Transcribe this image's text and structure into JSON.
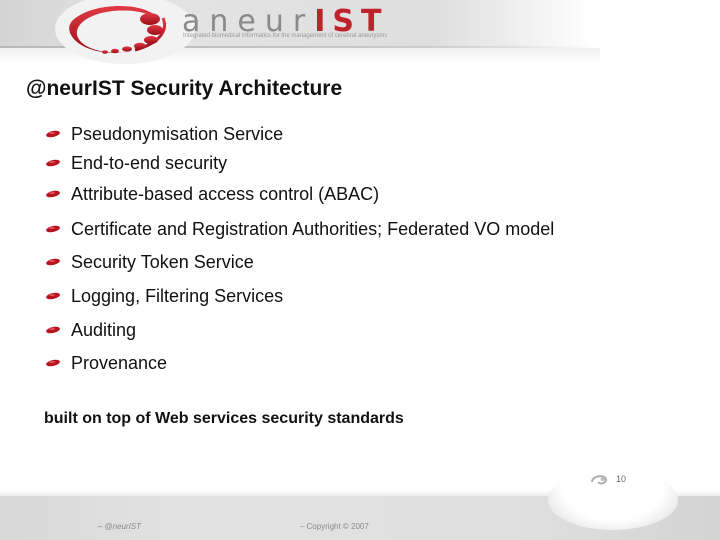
{
  "header": {
    "brand_prefix": "aneur",
    "brand_suffix": "IST",
    "tagline": "Integrated biomedical informatics for the management of cerebral aneurysms",
    "logo_icon": "red-swirl-logo-icon",
    "brand_color": "#c0222b"
  },
  "slide": {
    "title": "@neurIST Security Architecture",
    "bullet_icon": "red-oval-bullet-icon",
    "bullets": [
      {
        "label": "Pseudonymisation Service"
      },
      {
        "label": "End-to-end security"
      },
      {
        "label": "Attribute-based access control (ABAC)"
      },
      {
        "label": "Certificate and Registration Authorities; Federated VO model"
      },
      {
        "label": "Security Token Service"
      },
      {
        "label": "Logging, Filtering Services"
      },
      {
        "label": "Auditing"
      },
      {
        "label": "Provenance"
      }
    ],
    "note": "built on top of Web services security standards"
  },
  "footer": {
    "left_text": "@neurIST",
    "right_text": "Copyright © 2007",
    "page_number": "10",
    "page_icon": "swirl-page-icon"
  }
}
